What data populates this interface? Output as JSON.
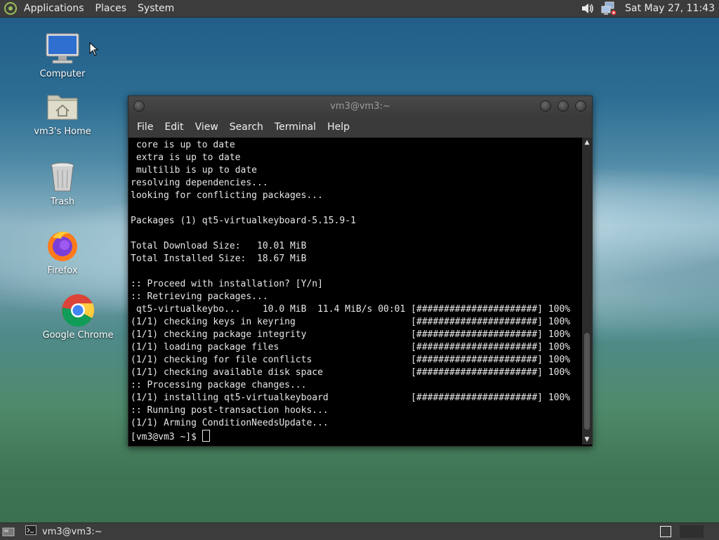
{
  "top_panel": {
    "menus": [
      "Applications",
      "Places",
      "System"
    ],
    "clock": "Sat May 27, 11:43",
    "tray_icons": [
      "volume-icon",
      "network-icon"
    ]
  },
  "desktop": {
    "icons": [
      {
        "label": "Computer",
        "icon": "computer-icon"
      },
      {
        "label": "vm3's Home",
        "icon": "home-folder-icon"
      },
      {
        "label": "Trash",
        "icon": "trash-icon"
      },
      {
        "label": "Firefox",
        "icon": "firefox-icon"
      },
      {
        "label": "Google Chrome",
        "icon": "chrome-icon"
      }
    ]
  },
  "terminal": {
    "title": "vm3@vm3:~",
    "menu": [
      "File",
      "Edit",
      "View",
      "Search",
      "Terminal",
      "Help"
    ],
    "lines": [
      " core is up to date",
      " extra is up to date",
      " multilib is up to date",
      "resolving dependencies...",
      "looking for conflicting packages...",
      "",
      "Packages (1) qt5-virtualkeyboard-5.15.9-1",
      "",
      "Total Download Size:   10.01 MiB",
      "Total Installed Size:  18.67 MiB",
      "",
      ":: Proceed with installation? [Y/n]",
      ":: Retrieving packages...",
      " qt5-virtualkeybo...    10.0 MiB  11.4 MiB/s 00:01 [######################] 100%",
      "(1/1) checking keys in keyring                     [######################] 100%",
      "(1/1) checking package integrity                   [######################] 100%",
      "(1/1) loading package files                        [######################] 100%",
      "(1/1) checking for file conflicts                  [######################] 100%",
      "(1/1) checking available disk space                [######################] 100%",
      ":: Processing package changes...",
      "(1/1) installing qt5-virtualkeyboard               [######################] 100%",
      ":: Running post-transaction hooks...",
      "(1/1) Arming ConditionNeedsUpdate..."
    ],
    "prompt": "[vm3@vm3 ~]$ "
  },
  "bottom_panel": {
    "task_label": "vm3@vm3:~"
  }
}
